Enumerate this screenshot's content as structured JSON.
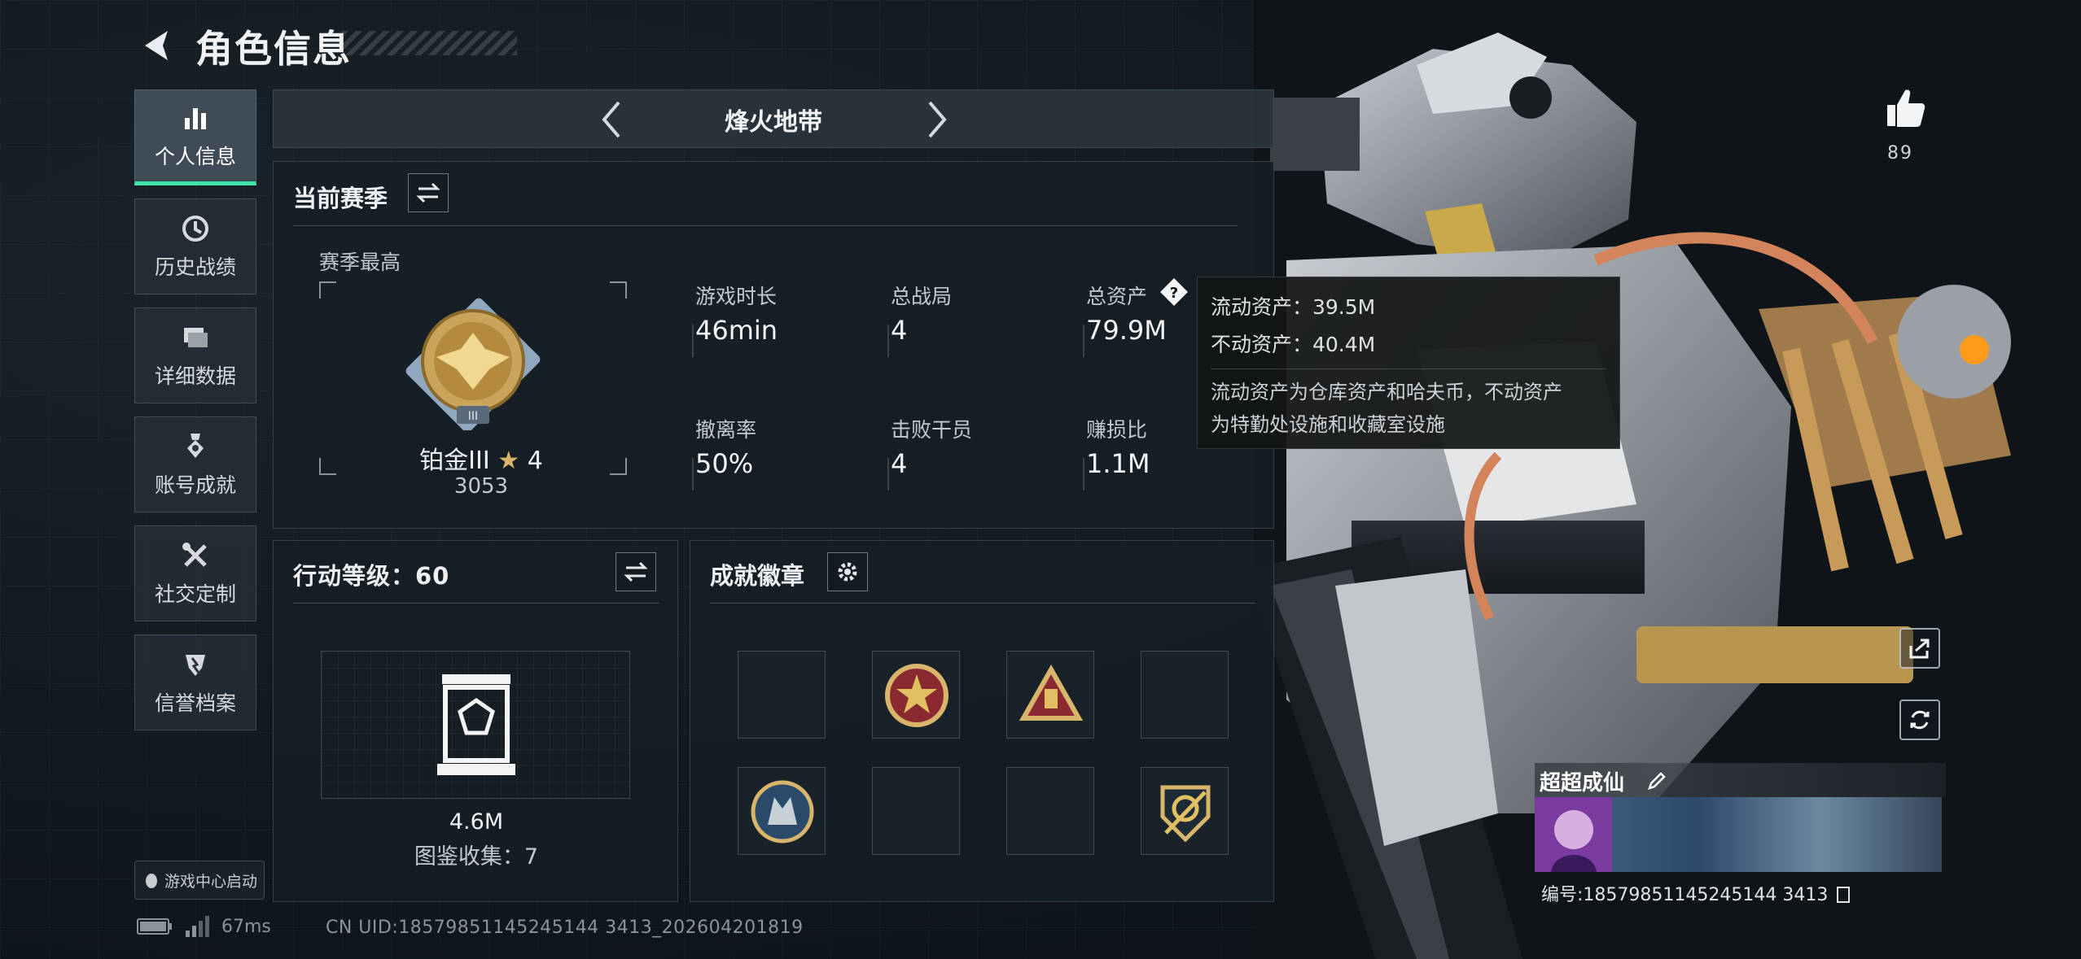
{
  "header": {
    "title": "角色信息"
  },
  "sidebar": {
    "items": [
      {
        "label": "个人信息",
        "icon": "bar-chart-icon",
        "active": true
      },
      {
        "label": "历史战绩",
        "icon": "clock-history-icon",
        "active": false
      },
      {
        "label": "详细数据",
        "icon": "folder-stack-icon",
        "active": false
      },
      {
        "label": "账号成就",
        "icon": "medal-icon",
        "active": false
      },
      {
        "label": "社交定制",
        "icon": "tools-icon",
        "active": false
      },
      {
        "label": "信誉档案",
        "icon": "shield-badge-icon",
        "active": false
      }
    ],
    "game_center": "游戏中心启动"
  },
  "season_nav": {
    "name": "烽火地带"
  },
  "current_season": {
    "title": "当前赛季",
    "best_label": "赛季最高",
    "rank": "铂金III",
    "stars": "4",
    "score": "3053",
    "stats": [
      {
        "key": "游戏时长",
        "value": "46min"
      },
      {
        "key": "总战局",
        "value": "4"
      },
      {
        "key": "总资产",
        "value": "79.9M"
      },
      {
        "key": "撤离率",
        "value": "50%"
      },
      {
        "key": "击败干员",
        "value": "4"
      },
      {
        "key": "赚损比",
        "value": "1.1M"
      }
    ]
  },
  "tooltip": {
    "liquid": "流动资产：39.5M",
    "fixed": "不动资产：40.4M",
    "desc1": "流动资产为仓库资产和哈夫币，不动资产",
    "desc2": "为特勤处设施和收藏室设施"
  },
  "action_level": {
    "title": "行动等级：60",
    "value": "4.6M",
    "collection": "图鉴收集：7"
  },
  "badges": {
    "title": "成就徽章"
  },
  "profile": {
    "likes": "89",
    "name": "超超成仙",
    "id": "编号:18579851145245144 3413"
  },
  "status": {
    "ping": "67ms",
    "uid": "CN UID:18579851145245144 3413_202604201819"
  },
  "colors": {
    "accent": "#3fe5a9",
    "gold": "#d8b56a"
  }
}
